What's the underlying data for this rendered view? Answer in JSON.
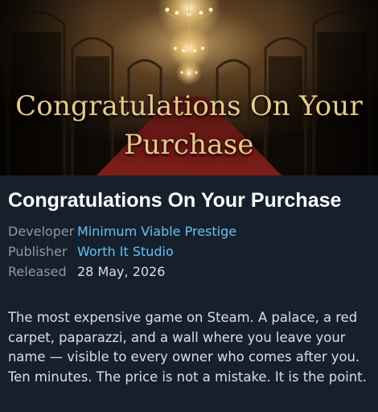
{
  "hero": {
    "title_line1": "Congratulations On Your",
    "title_line2": "Purchase"
  },
  "game": {
    "title": "Congratulations On Your Purchase",
    "details": {
      "developer_label": "Developer",
      "developer": "Minimum Viable Prestige",
      "publisher_label": "Publisher",
      "publisher": "Worth It Studio",
      "released_label": "Released",
      "released": "28 May, 2026"
    },
    "description": "The most expensive game on Steam. A palace, a red carpet, paparazzi, and a wall where you leave your name — visible to every owner who comes after you. Ten minutes. The price is not a mistake. It is the point."
  },
  "colors": {
    "background": "#16202d",
    "link": "#66c0f4",
    "label": "#8f98a0",
    "text": "#dcdedf",
    "hero_title": "#e7c98e"
  }
}
